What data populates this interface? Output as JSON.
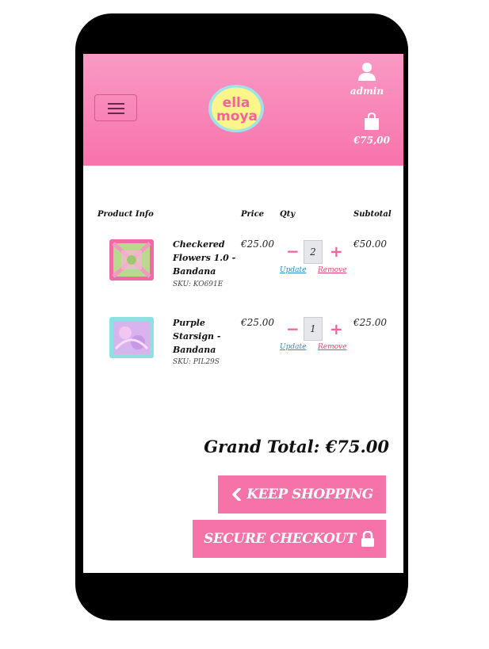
{
  "header": {
    "logo_text_top": "ella",
    "logo_text_bottom": "moya",
    "user_label": "admin",
    "bag_total": "€75,00"
  },
  "table": {
    "headers": {
      "product": "Product Info",
      "price": "Price",
      "qty": "Qty",
      "subtotal": "Subtotal"
    },
    "rows": [
      {
        "name": "Checkered Flowers 1.0 - Bandana",
        "sku": "SKU: KO691E",
        "price": "€25.00",
        "qty": "2",
        "subtotal": "€50.00",
        "update": "Update",
        "remove": "Remove"
      },
      {
        "name": "Purple Starsign - Bandana",
        "sku": "SKU: PIL29S",
        "price": "€25.00",
        "qty": "1",
        "subtotal": "€25.00",
        "update": "Update",
        "remove": "Remove"
      }
    ]
  },
  "summary": {
    "grand_total": "Grand Total: €75.00"
  },
  "buttons": {
    "keep_shopping": "KEEP SHOPPING",
    "secure_checkout": "SECURE CHECKOUT"
  },
  "icons": {
    "menu": "hamburger-icon",
    "user": "user-icon",
    "bag": "shopping-bag-icon",
    "back": "chevron-left-icon",
    "lock": "lock-icon",
    "minus": "minus-icon",
    "plus": "plus-icon"
  },
  "colors": {
    "brand_pink": "#f773ab",
    "logo_yellow": "#fbf58a",
    "logo_ring": "#9fe3e8",
    "button_pink": "#f573a9"
  }
}
